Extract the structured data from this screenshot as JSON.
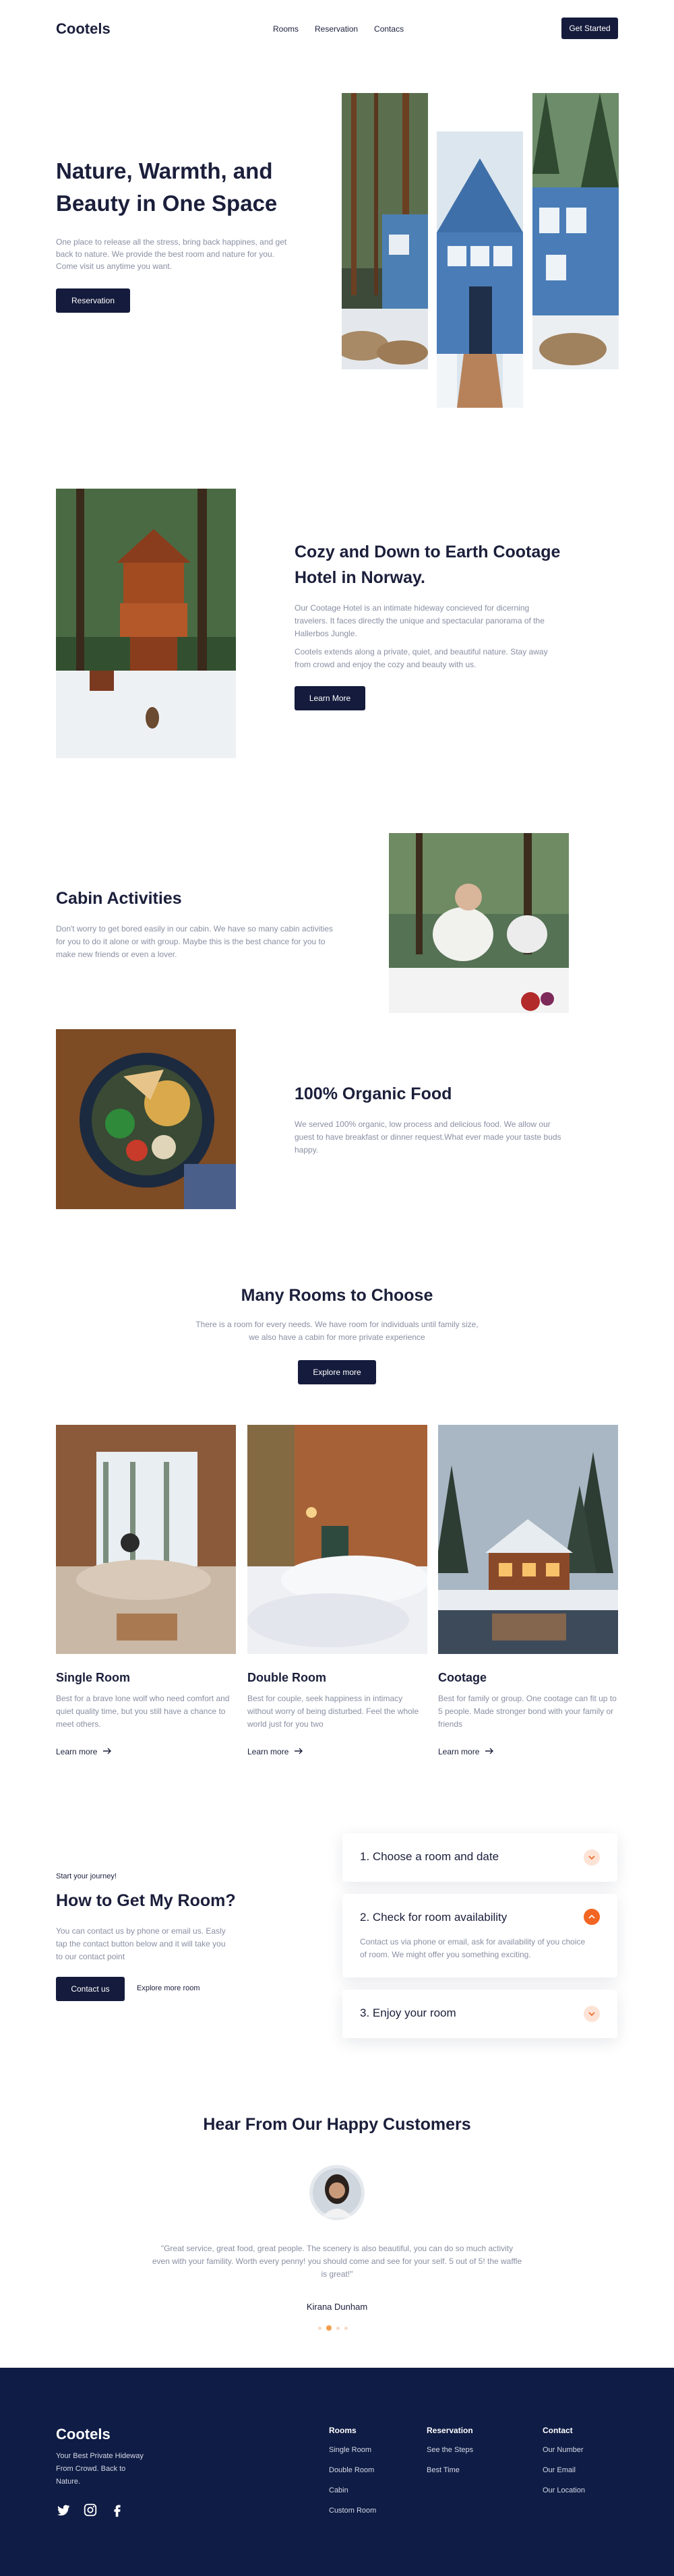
{
  "nav": {
    "logo": "Cootels",
    "links": [
      "Rooms",
      "Reservation",
      "Contacs"
    ],
    "cta": "Get Started"
  },
  "hero": {
    "title": "Nature, Warmth, and Beauty in One Space",
    "subtitle": "One place to release all the stress, bring back happines, and get back to nature. We provide the best room and nature for you. Come visit us anytime you want.",
    "button": "Reservation"
  },
  "about": {
    "title": "Cozy and Down to Earth Cootage Hotel in Norway.",
    "paragraph1": "Our Cootage Hotel is an intimate hideway concieved for dicerning travelers. It faces directly the unique and spectacular panorama of the Hallerbos Jungle.",
    "paragraph2": "Cootels extends along a private, quiet, and beautiful nature. Stay away from crowd and enjoy the cozy and beauty with us.",
    "button": "Learn More"
  },
  "activities": {
    "title": "Cabin Activities",
    "text": "Don't worry to get bored easily in our cabin. We have so many cabin activities for you to do it alone or with group. Maybe this is the best chance for you to make new friends or even a lover."
  },
  "food": {
    "title": "100% Organic Food",
    "text": "We served 100% organic, low process and delicious food. We allow our guest to have breakfast or dinner request.What ever made your taste buds happy."
  },
  "rooms": {
    "title": "Many Rooms to Choose",
    "subtitle": "There is a room for every needs. We have room for individuals until family size, we also have a cabin for more private experience",
    "button": "Explore more",
    "items": [
      {
        "name": "Single Room",
        "desc": "Best for a brave lone wolf who need comfort and quiet quality time, but you still have a chance to meet others.",
        "link": "Learn more"
      },
      {
        "name": "Double Room",
        "desc": "Best for couple, seek happiness in intimacy without worry of being disturbed. Feel the whole world just for you two",
        "link": "Learn more"
      },
      {
        "name": "Cootage",
        "desc": "Best for family or group. One cootage can fit up to 5 people. Made stronger bond with your family or friends",
        "link": "Learn more"
      }
    ]
  },
  "howto": {
    "eyebrow": "Start your journey!",
    "title": "How to Get My Room?",
    "text": "You can contact us by phone or email us. Easly tap the contact button below and it will take you to our contact point",
    "primary": "Contact us",
    "secondary": "Explore more room",
    "steps": [
      {
        "title": "1. Choose a room and date",
        "open": false
      },
      {
        "title": "2. Check for room availability",
        "open": true,
        "body": "Contact us via phone or email, ask for availability of you choice of room. We might offer you something exciting."
      },
      {
        "title": "3. Enjoy your room",
        "open": false
      }
    ]
  },
  "testimonial": {
    "title": "Hear From Our Happy Customers",
    "quote": "\"Great service, great food, great people. The scenery is also beautiful, you can do so much activity even with your famility. Worth every penny! you should come and see for your self. 5 out of 5! the waffle is great!\"",
    "name": "Kirana Dunham",
    "dots": 4,
    "active": 1
  },
  "footer": {
    "logo": "Cootels",
    "tagline": "Your Best Private Hideway From Crowd. Back to Nature.",
    "columns": [
      {
        "heading": "Rooms",
        "links": [
          "Single Room",
          "Double Room",
          "Cabin",
          "Custom Room"
        ]
      },
      {
        "heading": "Reservation",
        "links": [
          "See the Steps",
          "Best Time"
        ]
      },
      {
        "heading": "Contact",
        "links": [
          "Our Number",
          "Our Email",
          "Our Location"
        ]
      }
    ],
    "social": [
      "twitter-icon",
      "instagram-icon",
      "facebook-icon"
    ]
  },
  "colors": {
    "primary": "#141b3c",
    "accent": "#f26522",
    "footer_bg": "#0f1c45",
    "muted_text": "#8a8fa3"
  }
}
